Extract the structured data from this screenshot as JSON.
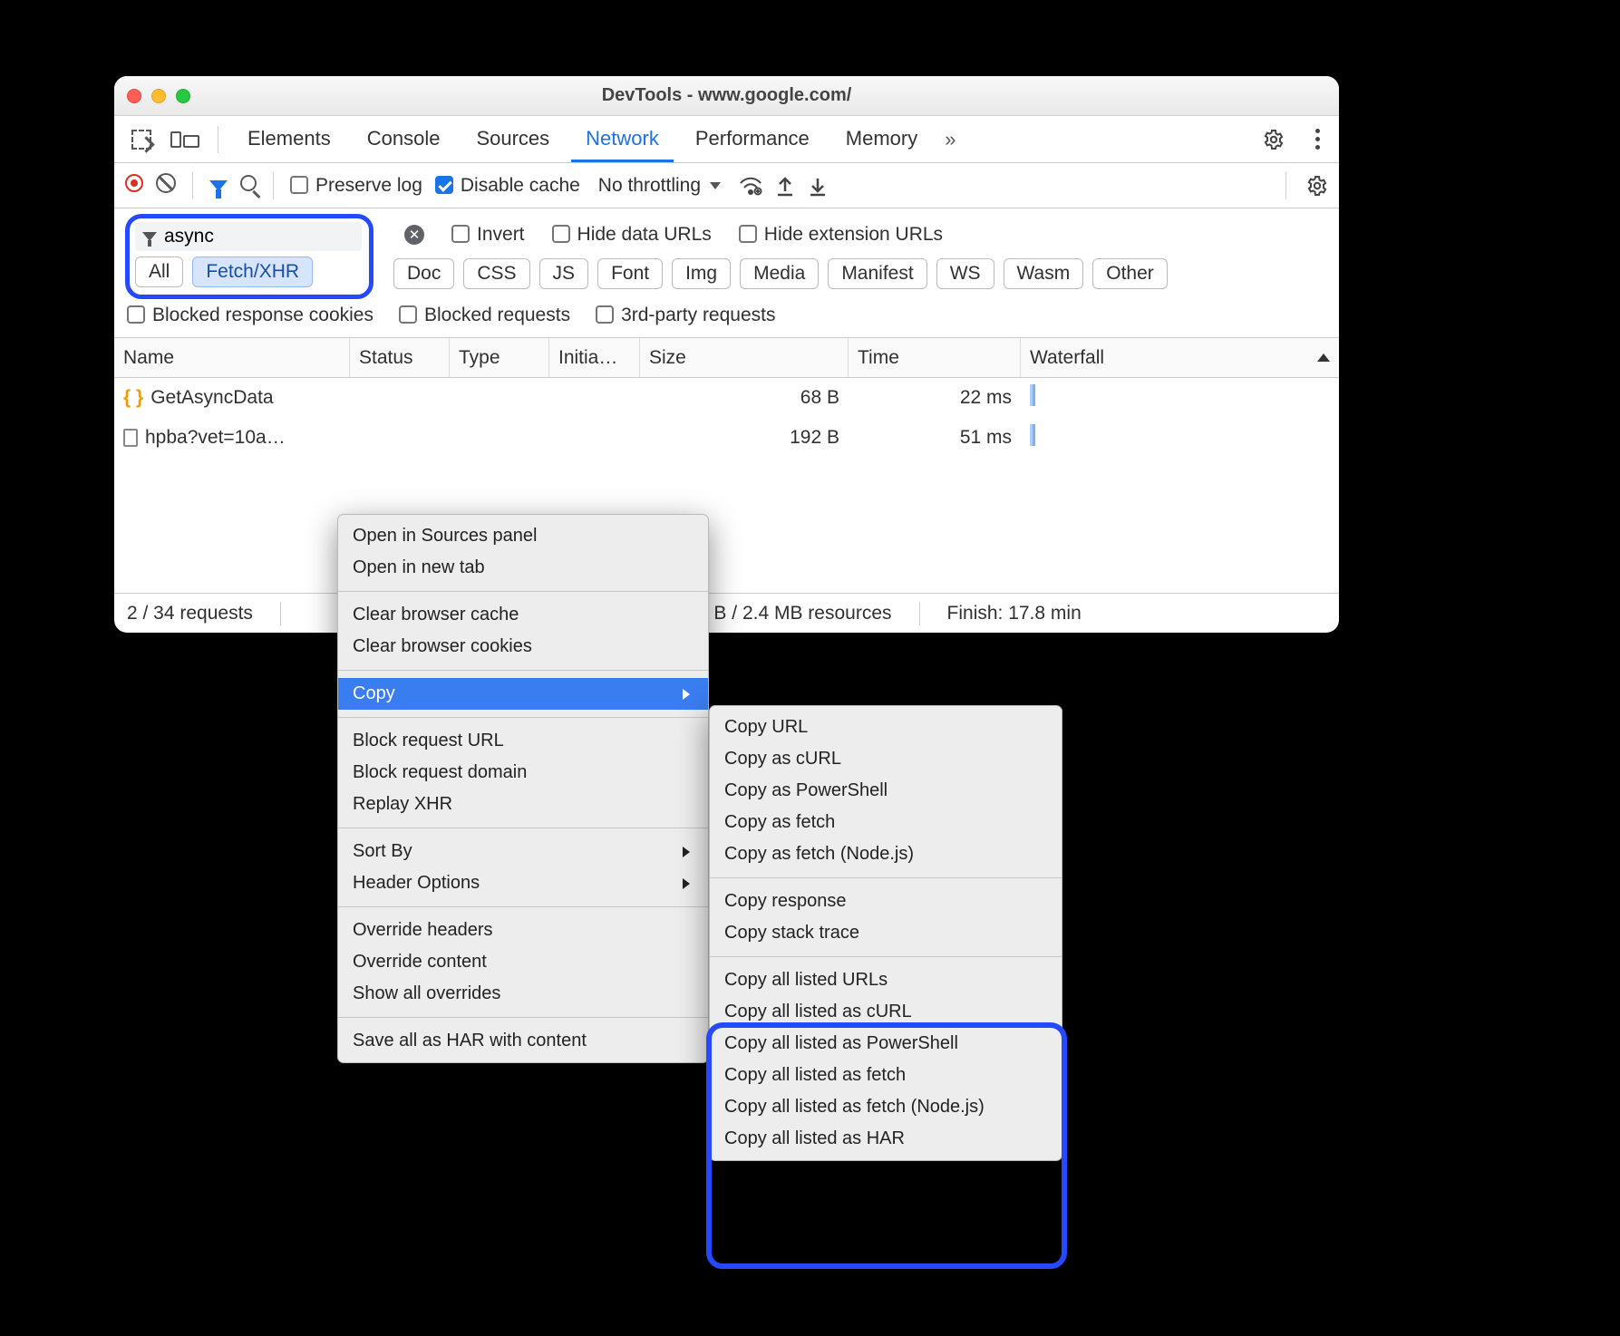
{
  "window": {
    "title": "DevTools - www.google.com/"
  },
  "panel_tabs": {
    "items": [
      "Elements",
      "Console",
      "Sources",
      "Network",
      "Performance",
      "Memory"
    ],
    "active": "Network",
    "overflow_glyph": "»"
  },
  "toolbar": {
    "preserve_log": "Preserve log",
    "disable_cache": "Disable cache",
    "throttling": "No throttling"
  },
  "filter": {
    "value": "async",
    "invert": "Invert",
    "hide_data_urls": "Hide data URLs",
    "hide_ext_urls": "Hide extension URLs",
    "chips_first": [
      "All",
      "Fetch/XHR"
    ],
    "chip_active_index": 1,
    "chips_rest": [
      "Doc",
      "CSS",
      "JS",
      "Font",
      "Img",
      "Media",
      "Manifest",
      "WS",
      "Wasm",
      "Other"
    ],
    "blocked_cookies": "Blocked response cookies",
    "blocked_requests": "Blocked requests",
    "third_party": "3rd-party requests"
  },
  "columns": [
    "Name",
    "Status",
    "Type",
    "Initia…",
    "Size",
    "Time",
    "Waterfall"
  ],
  "rows": [
    {
      "icon": "json",
      "name": "GetAsyncData",
      "size": "68 B",
      "time": "22 ms"
    },
    {
      "icon": "file",
      "name": "hpba?vet=10a…",
      "size": "192 B",
      "time": "51 ms"
    }
  ],
  "status": {
    "requests": "2 / 34 requests",
    "resources": "5 B / 2.4 MB resources",
    "finish": "Finish: 17.8 min"
  },
  "ctx_main": [
    {
      "t": "item",
      "label": "Open in Sources panel"
    },
    {
      "t": "item",
      "label": "Open in new tab"
    },
    {
      "t": "div"
    },
    {
      "t": "item",
      "label": "Clear browser cache"
    },
    {
      "t": "item",
      "label": "Clear browser cookies"
    },
    {
      "t": "div"
    },
    {
      "t": "item",
      "label": "Copy",
      "submenu": true,
      "hl": true
    },
    {
      "t": "div"
    },
    {
      "t": "item",
      "label": "Block request URL"
    },
    {
      "t": "item",
      "label": "Block request domain"
    },
    {
      "t": "item",
      "label": "Replay XHR"
    },
    {
      "t": "div"
    },
    {
      "t": "item",
      "label": "Sort By",
      "submenu": true
    },
    {
      "t": "item",
      "label": "Header Options",
      "submenu": true
    },
    {
      "t": "div"
    },
    {
      "t": "item",
      "label": "Override headers"
    },
    {
      "t": "item",
      "label": "Override content"
    },
    {
      "t": "item",
      "label": "Show all overrides"
    },
    {
      "t": "div"
    },
    {
      "t": "item",
      "label": "Save all as HAR with content"
    }
  ],
  "ctx_sub": [
    {
      "t": "item",
      "label": "Copy URL"
    },
    {
      "t": "item",
      "label": "Copy as cURL"
    },
    {
      "t": "item",
      "label": "Copy as PowerShell"
    },
    {
      "t": "item",
      "label": "Copy as fetch"
    },
    {
      "t": "item",
      "label": "Copy as fetch (Node.js)"
    },
    {
      "t": "div"
    },
    {
      "t": "item",
      "label": "Copy response"
    },
    {
      "t": "item",
      "label": "Copy stack trace"
    },
    {
      "t": "div"
    },
    {
      "t": "item",
      "label": "Copy all listed URLs"
    },
    {
      "t": "item",
      "label": "Copy all listed as cURL"
    },
    {
      "t": "item",
      "label": "Copy all listed as PowerShell"
    },
    {
      "t": "item",
      "label": "Copy all listed as fetch"
    },
    {
      "t": "item",
      "label": "Copy all listed as fetch (Node.js)"
    },
    {
      "t": "item",
      "label": "Copy all listed as HAR"
    }
  ]
}
